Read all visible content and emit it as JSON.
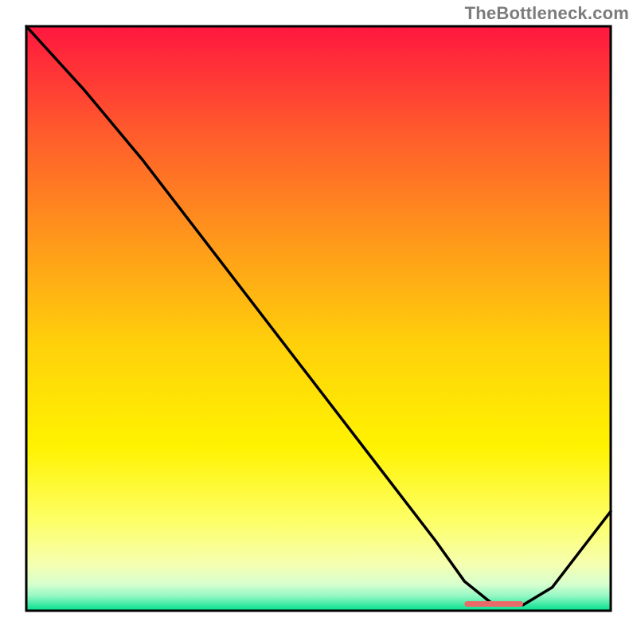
{
  "watermark": "TheBottleneck.com",
  "chart_data": {
    "type": "line",
    "title": "",
    "xlabel": "",
    "ylabel": "",
    "xlim": [
      0,
      100
    ],
    "ylim": [
      0,
      100
    ],
    "grid": false,
    "legend": false,
    "series": [
      {
        "name": "curve",
        "x": [
          0,
          10,
          20,
          30,
          40,
          50,
          60,
          70,
          75,
          80,
          85,
          90,
          100
        ],
        "y": [
          100,
          89,
          77,
          64,
          51,
          38,
          25,
          12,
          5,
          1,
          1,
          4,
          17
        ]
      }
    ],
    "flat_band_x": [
      75,
      85
    ],
    "background": {
      "stops": [
        {
          "offset": 0.0,
          "color": "#ff173f"
        },
        {
          "offset": 0.18,
          "color": "#ff5a2c"
        },
        {
          "offset": 0.38,
          "color": "#ff9d19"
        },
        {
          "offset": 0.55,
          "color": "#ffd20a"
        },
        {
          "offset": 0.72,
          "color": "#fff300"
        },
        {
          "offset": 0.85,
          "color": "#fdff6a"
        },
        {
          "offset": 0.92,
          "color": "#f6ffb0"
        },
        {
          "offset": 0.955,
          "color": "#d7ffce"
        },
        {
          "offset": 0.975,
          "color": "#93f7c3"
        },
        {
          "offset": 1.0,
          "color": "#00e08e"
        }
      ]
    },
    "flat_marker_color": "#ea6a6a"
  }
}
